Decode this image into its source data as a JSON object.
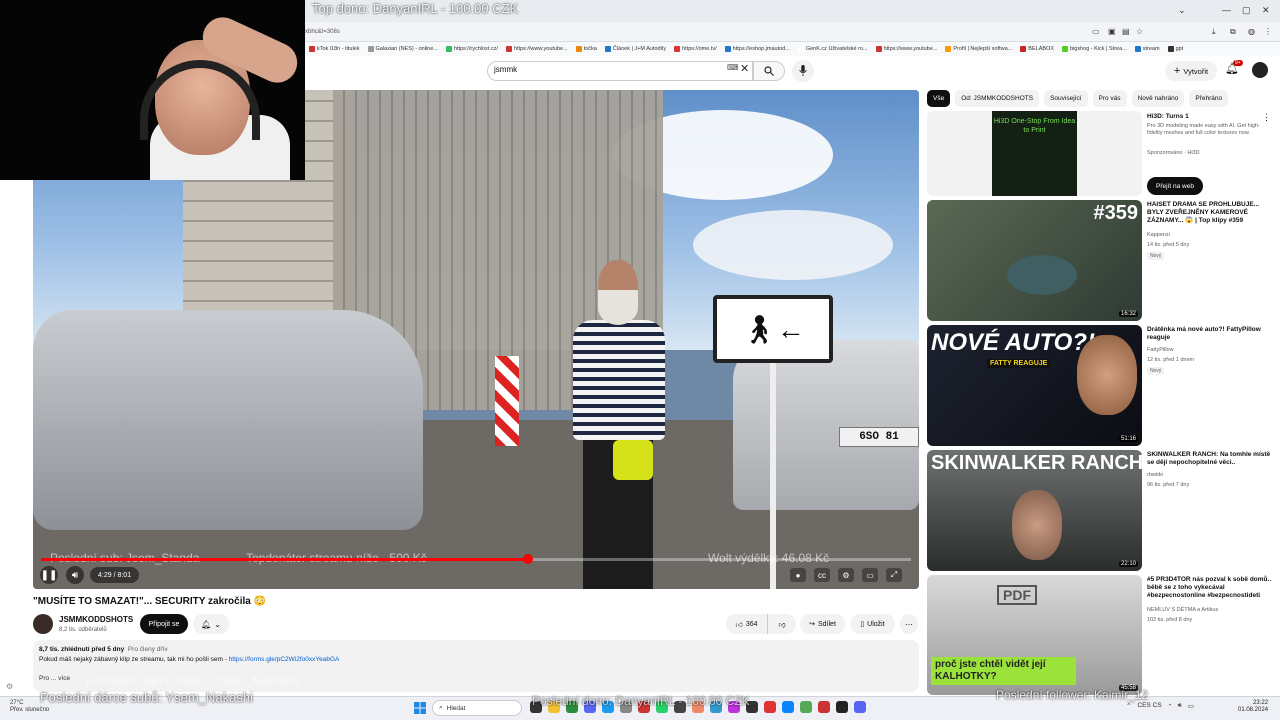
{
  "stream_overlay": {
    "top_donation": "Top dono: DanyanIRL - 100.00 CZK",
    "last_sub": "Poslední sub: Jsem_Standa",
    "top_donator": "Topdonátor streamu níže - 500 Kč",
    "wolt": "Wolt výdělky: 46.08 Kč",
    "last_gift_sub": "Poslední dárce subů: Ysem_Nakashi",
    "last_gift_sub_shadow": "Poslední dárce subů: Ysem_Nakashi",
    "bottom_donation": "Poslední dono: DanyanIRL - 100.00 CZK",
    "last_follower": "Poslední follower: Kaimir_12"
  },
  "browser": {
    "url": "xbhc&t=308s",
    "bookmarks": [
      {
        "label": "kTok i18n - titulek"
      },
      {
        "label": "Galaxian (NES) - online..."
      },
      {
        "label": "https://rychlost.cz/"
      },
      {
        "label": "https://www.youtube..."
      },
      {
        "label": "točka"
      },
      {
        "label": "Článek | J+M Autodíly"
      },
      {
        "label": "https://ome.tv/"
      },
      {
        "label": "https://eshop.jmautod..."
      },
      {
        "label": "GenK.cz Uživatelské ro..."
      },
      {
        "label": "https://www.youtube..."
      },
      {
        "label": "Profil | Nejlepší softwa..."
      },
      {
        "label": "BELABOX"
      },
      {
        "label": "bigshog - Kick | Strea..."
      },
      {
        "label": "stream"
      },
      {
        "label": "gpt"
      }
    ]
  },
  "header": {
    "search_value": "jsmmk",
    "create_label": "Vytvořit",
    "notif_count": "9+"
  },
  "player": {
    "plate_text": "6SO 81",
    "current_time": "4:29 / 8:01",
    "progress_fraction": 0.56
  },
  "video": {
    "title": "\"MUSÍTE TO SMAZAT!\"... SECURITY zakročila 😳",
    "channel_name": "JSMMKODDSHOTS",
    "channel_subs": "8,2 tis. odběratelů",
    "subscribe_label": "Připojit se",
    "likes": "364",
    "share_label": "Sdílet",
    "save_label": "Uložit",
    "views_date": "8,7 tis. zhlédnutí  před 5 dny",
    "members_tag": "Pro členy dřív",
    "desc_text": "Pokud máš nejaký zábavný klip ze streamu, tak mi ho pošli sem - ",
    "desc_link": "https://forms.gle/pC2Wi2fo0xxYeabGA",
    "desc_more": "Pro ... více"
  },
  "chips": [
    "Vše",
    "Od: JSMMKODDSHOTS",
    "Související",
    "Pro vás",
    "Nově nahráno",
    "Přehráno"
  ],
  "sidebar": [
    {
      "title": "Hi3D: Turns 1",
      "desc": "Pro 3D modeling made easy with AI. Get high-fidelity meshes and full color textures now.",
      "meta": "Sponzorováno · Hi3D",
      "cta": "Přejít na web",
      "thumb_text": "Hi3D One-Stop From Idea to Print"
    },
    {
      "title": "HAISET DRAMA SE PROHLUBUJE... BYLY ZVEŘEJNĚNY KAMEROVÉ ZÁZNAMY... 😱 | Top klipy #359",
      "channel": "Kappenzi",
      "meta": "14 tis.  před 5 dny",
      "badge": "Nový",
      "duration": "16:32",
      "thumb_text": "#359"
    },
    {
      "title": "Drátěnka má nové auto?! FattyPillow reaguje",
      "channel": "FattyPillow",
      "meta": "12 tis.  před 1 dnem",
      "badge": "Nový",
      "duration": "51:16",
      "thumb_text": "NOVÉ AUTO?!",
      "thumb_sub": "FATTY REAGUJE"
    },
    {
      "title": "SKINWALKER RANCH: Na tomhle místě se dějí nepochopitelné věci..",
      "channel": "rbwido",
      "meta": "96 tis.  před 7 dny",
      "duration": "22:10",
      "thumb_text": "SKINWALKER RANCH"
    },
    {
      "title": "#5 PR3D4TOR nás pozval k sobě domů.. běbě se z toho vykecával #bezpecnostonline #bezpecnostideti",
      "channel": "NEMLUV S DĚTMA a Artikus",
      "meta": "102 tis.  před 8 dny",
      "duration": "45:58",
      "thumb_text": "proč jste chtěl vidět její KALHOTKY?",
      "thumb_pdf": "PDF"
    }
  ],
  "taskbar": {
    "temp": "27°C",
    "weather": "Přev. slunečno",
    "search": "Hledat",
    "lang": "CES CS",
    "time": "23:22",
    "date": "01.08.2024"
  }
}
